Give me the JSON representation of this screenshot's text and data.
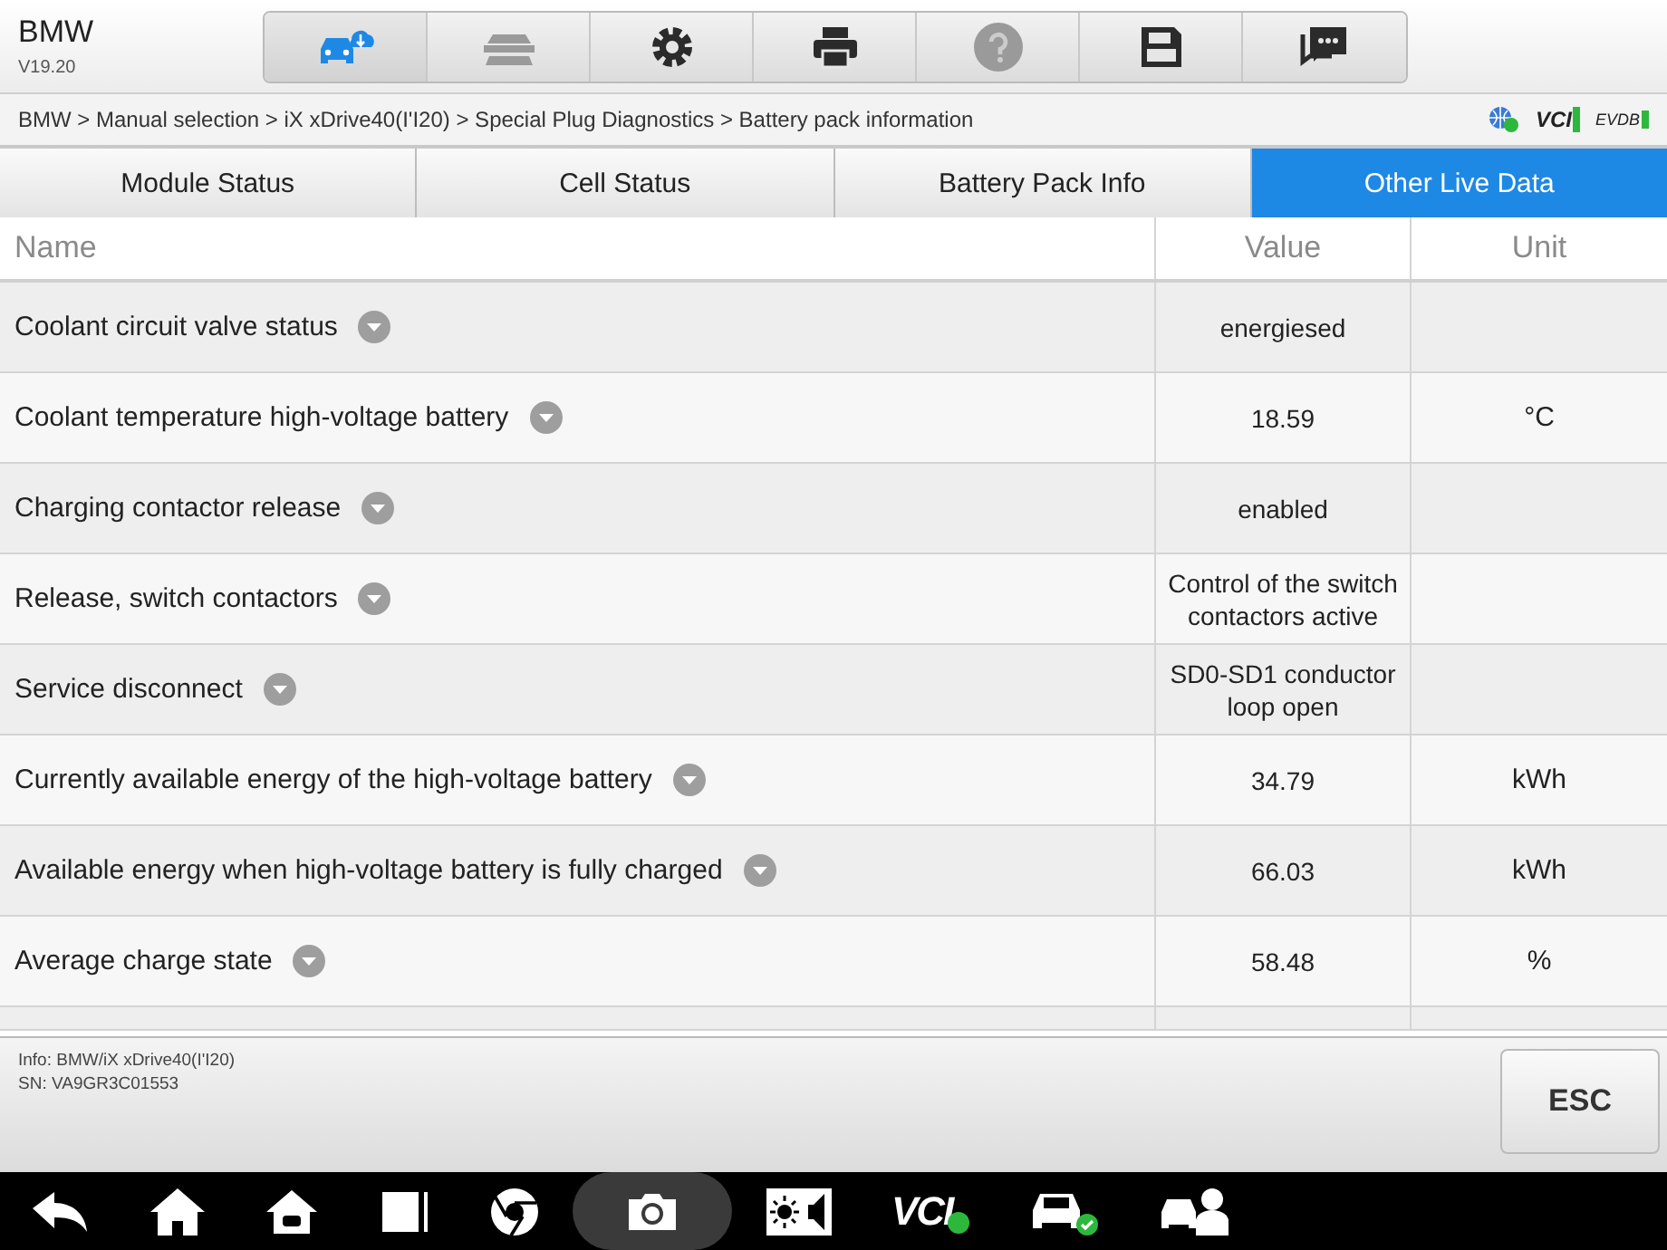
{
  "header": {
    "title": "BMW",
    "version": "V19.20",
    "toolbar": [
      {
        "kind": "car-cloud",
        "selected": true,
        "disabled": false
      },
      {
        "kind": "cars",
        "selected": false,
        "disabled": true
      },
      {
        "kind": "gear",
        "selected": false,
        "disabled": false
      },
      {
        "kind": "printer",
        "selected": false,
        "disabled": false
      },
      {
        "kind": "help",
        "selected": false,
        "disabled": true
      },
      {
        "kind": "save",
        "selected": false,
        "disabled": false
      },
      {
        "kind": "chat",
        "selected": false,
        "disabled": false
      }
    ]
  },
  "breadcrumb": "BMW > Manual selection > iX xDrive40(I'I20) > Special Plug Diagnostics > Battery pack information",
  "status": {
    "vci": "VCI",
    "evdb": "EVDB"
  },
  "tabs": [
    {
      "label": "Module Status",
      "selected": false
    },
    {
      "label": "Cell Status",
      "selected": false
    },
    {
      "label": "Battery Pack Info",
      "selected": false
    },
    {
      "label": "Other Live Data",
      "selected": true
    }
  ],
  "table": {
    "columns": [
      "Name",
      "Value",
      "Unit"
    ],
    "rows": [
      {
        "name": "Coolant circuit valve status",
        "value": "energiesed"
      },
      {
        "name": "Coolant temperature high-voltage battery",
        "value": "18.59",
        "unit": "°C"
      },
      {
        "name": "Charging contactor release",
        "value": "enabled"
      },
      {
        "name": "Release, switch contactors",
        "value": "Control of the switch contactors active"
      },
      {
        "name": "Service disconnect",
        "value": "SD0-SD1 conductor loop open"
      },
      {
        "name": "Currently available energy of the high-voltage battery",
        "value": "34.79",
        "unit": "kWh"
      },
      {
        "name": "Available energy when high-voltage battery is fully charged",
        "value": "66.03",
        "unit": "kWh"
      },
      {
        "name": "Average charge state",
        "value": "58.48",
        "unit": "%"
      }
    ]
  },
  "footer": {
    "info": "Info: BMW/iX xDrive40(I'I20)",
    "sn": "SN: VA9GR3C01553",
    "button": "ESC"
  },
  "navbar": {
    "vci": "VCI"
  }
}
